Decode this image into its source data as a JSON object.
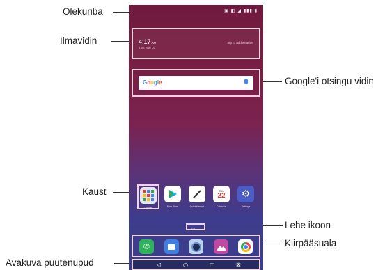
{
  "callouts": {
    "status_bar": "Olekuriba",
    "weather_widget": "Ilmavidin",
    "google_search_widget": "Google'i otsingu vidin",
    "folder": "Kaust",
    "page_icon": "Lehe ikoon",
    "quick_access": "Kiirpääsuala",
    "home_touch_buttons": "Avakuva puutenupud"
  },
  "phone": {
    "status_icons": "▣ ◧ ◢ ▮▮▮ ▮",
    "weather": {
      "time": "4:17",
      "time_suffix": "AM",
      "date": "Thu, Mar 01",
      "tap_text": "Tap to add weather"
    },
    "search": {
      "logo": "Google",
      "mic_icon": "mic-icon"
    },
    "apps": [
      {
        "label": "Google",
        "icon": "folder-icon"
      },
      {
        "label": "Play Store",
        "icon": "play-store-icon"
      },
      {
        "label": "QuickMemo+",
        "icon": "quickmemo-icon"
      },
      {
        "label": "Calendar",
        "icon": "calendar-icon",
        "day_name": "THU",
        "day_num": "22"
      },
      {
        "label": "Settings",
        "icon": "settings-icon"
      }
    ],
    "page_indicator": "⌂ •",
    "quick_apps": [
      {
        "icon": "phone-icon"
      },
      {
        "icon": "messaging-icon"
      },
      {
        "icon": "camera-icon"
      },
      {
        "icon": "gallery-icon"
      },
      {
        "icon": "chrome-icon"
      }
    ],
    "nav_buttons": [
      "◁",
      "○",
      "□",
      "⊠"
    ]
  },
  "colors": {
    "accent_border": "#f1d4df",
    "wallpaper_top": "#6e1a3e",
    "wallpaper_bottom": "#3a3e8e"
  }
}
